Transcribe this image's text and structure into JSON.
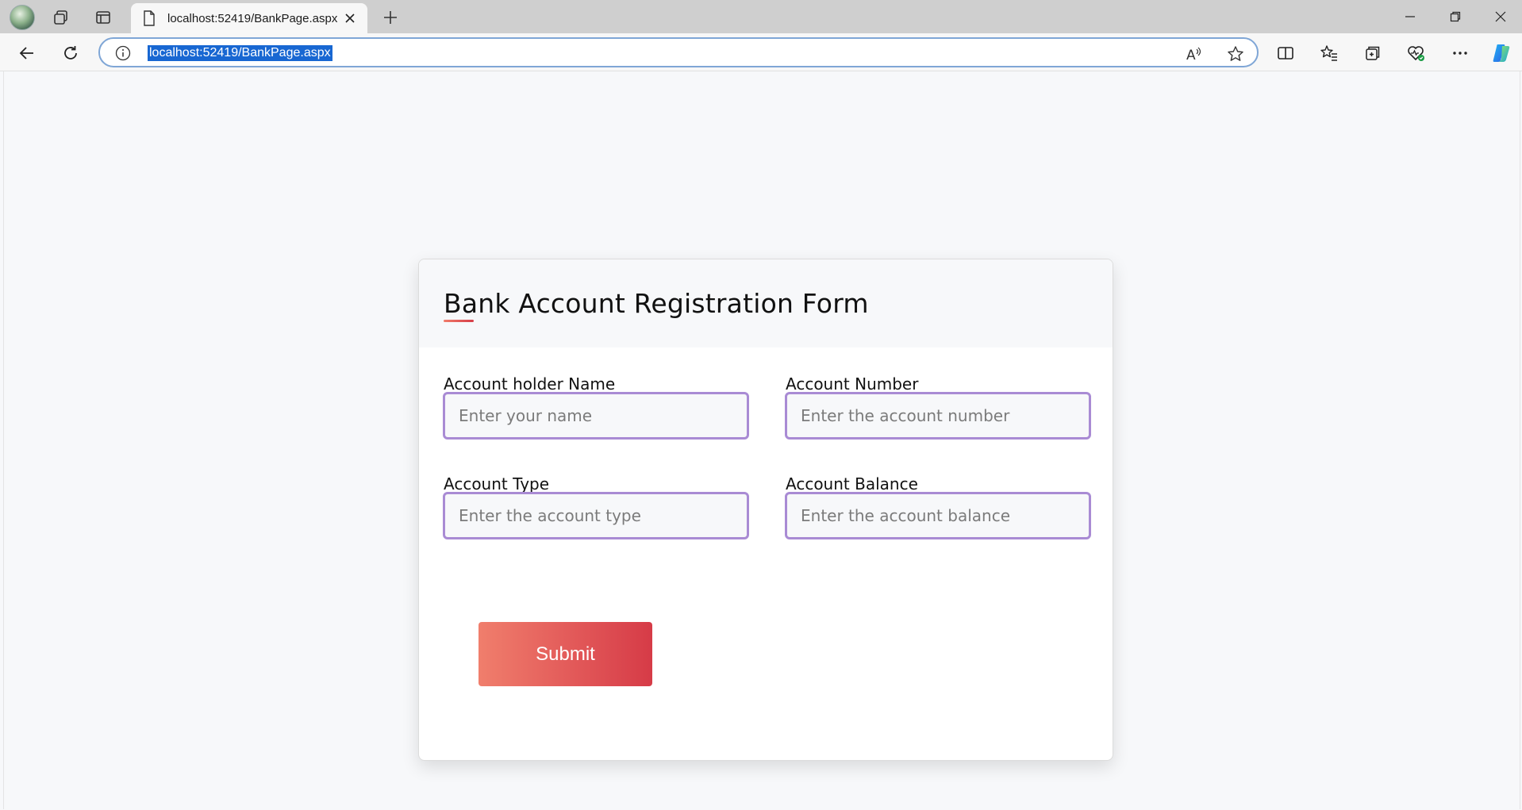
{
  "browser": {
    "tab_title": "localhost:52419/BankPage.aspx",
    "url": "localhost:52419/BankPage.aspx"
  },
  "form": {
    "title": "Bank Account Registration Form",
    "fields": [
      {
        "label": "Account holder Name",
        "placeholder": "Enter your name"
      },
      {
        "label": "Account Number",
        "placeholder": "Enter the account number"
      },
      {
        "label": "Account Type",
        "placeholder": "Enter the account type"
      },
      {
        "label": "Account Balance",
        "placeholder": "Enter the account balance"
      }
    ],
    "submit_label": "Submit"
  },
  "colors": {
    "accent_start": "#f07e6c",
    "accent_end": "#d63b47",
    "input_border": "#a98bd4",
    "url_highlight": "#1867d2"
  }
}
